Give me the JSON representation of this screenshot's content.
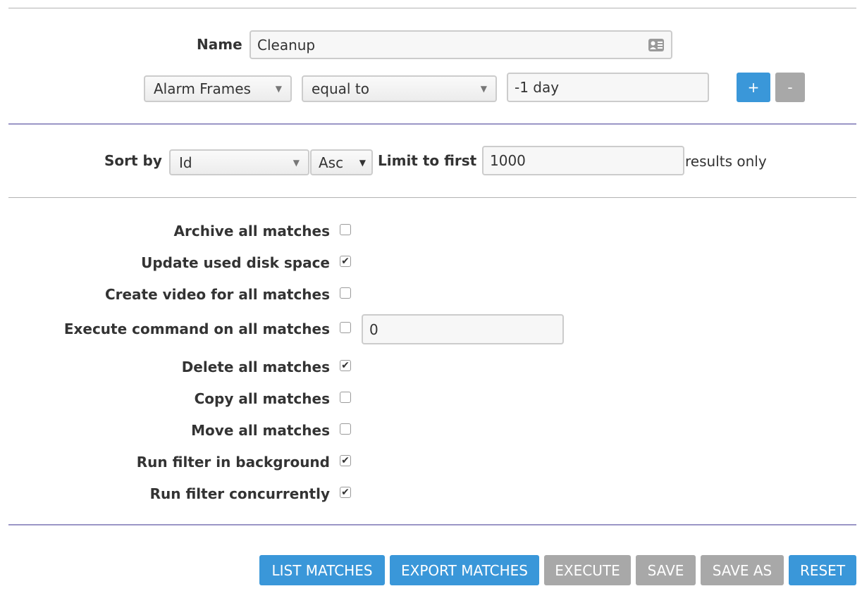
{
  "filter": {
    "name_label": "Name",
    "name_value": "Cleanup",
    "term": {
      "attribute": "Alarm Frames",
      "operator": "equal to",
      "value": "-1 day",
      "add_label": "+",
      "remove_label": "-"
    }
  },
  "sort": {
    "label": "Sort by",
    "field": "Id",
    "direction": "Asc",
    "limit_label": "Limit to first",
    "limit_value": "1000",
    "limit_suffix": "results only"
  },
  "options": [
    {
      "label": "Archive all matches",
      "checked": false
    },
    {
      "label": "Update used disk space",
      "checked": true
    },
    {
      "label": "Create video for all matches",
      "checked": false
    },
    {
      "label": "Execute command on all matches",
      "checked": false,
      "input_value": "0"
    },
    {
      "label": "Delete all matches",
      "checked": true
    },
    {
      "label": "Copy all matches",
      "checked": false
    },
    {
      "label": "Move all matches",
      "checked": false
    },
    {
      "label": "Run filter in background",
      "checked": true
    },
    {
      "label": "Run filter concurrently",
      "checked": true
    }
  ],
  "check_mark": "✔",
  "buttons": {
    "list": "LIST MATCHES",
    "export": "EXPORT MATCHES",
    "execute": "EXECUTE",
    "save": "SAVE",
    "save_as": "SAVE AS",
    "reset": "RESET"
  },
  "colors": {
    "primary": "#3a97d9",
    "disabled": "#a8a8a8",
    "divider_accent": "#9b96c6"
  }
}
